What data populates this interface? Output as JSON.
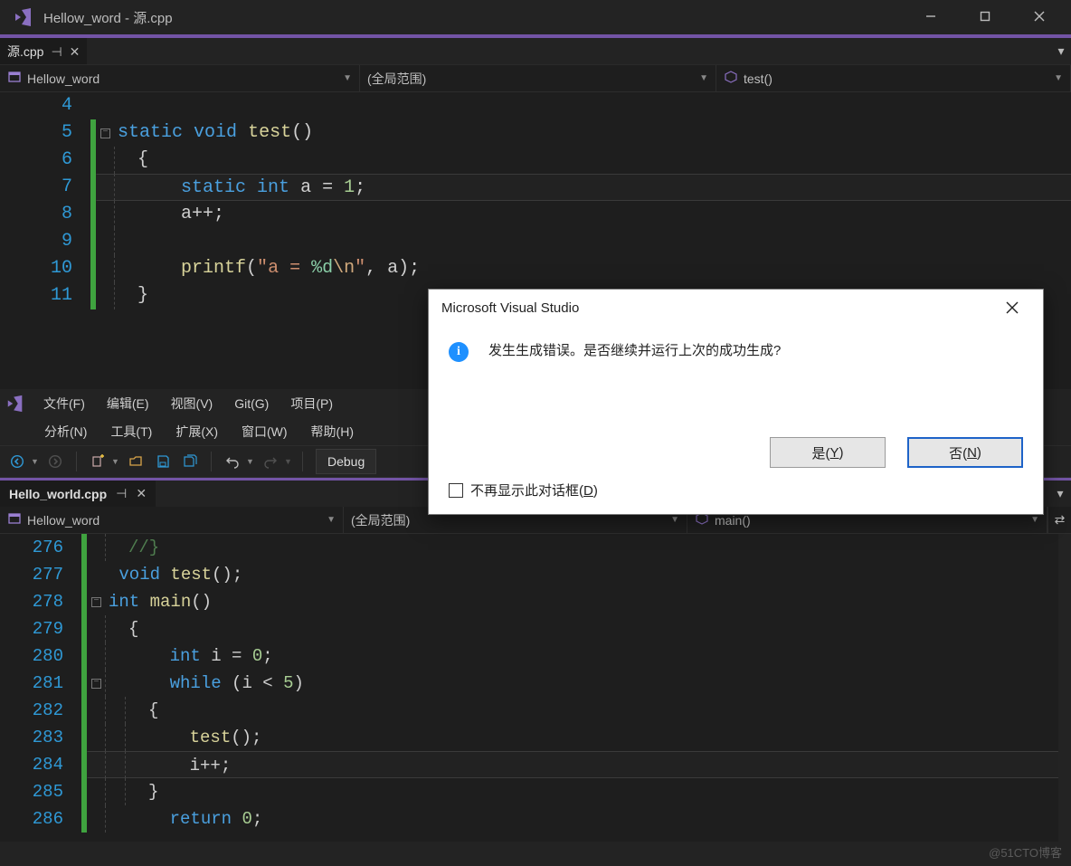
{
  "window1": {
    "title": "Hellow_word - 源.cpp",
    "tab": {
      "label": "源.cpp"
    },
    "nav": {
      "project": "Hellow_word",
      "scope": "(全局范围)",
      "member": "test()"
    },
    "lines": {
      "4": "",
      "5": {
        "kw1": "static",
        "kw2": "void",
        "fn": "test",
        "rest": "()"
      },
      "6": "{",
      "7": {
        "kw1": "static",
        "kw2": "int",
        "id": "a",
        "eq": "=",
        "num": "1",
        "semi": ";"
      },
      "8": {
        "id": "a",
        "op": "++",
        "semi": ";"
      },
      "9": "",
      "10": {
        "fn": "printf",
        "open": "(",
        "q1": "\"",
        "lit": "a = ",
        "fmt": "%d",
        "esc": "\\n",
        "q2": "\"",
        "comma": ", ",
        "arg": "a",
        "close": ")",
        "semi": ";"
      },
      "11": "}"
    }
  },
  "window2": {
    "menu_row1": [
      "文件(F)",
      "编辑(E)",
      "视图(V)",
      "Git(G)",
      "项目(P)"
    ],
    "menu_row2": [
      "分析(N)",
      "工具(T)",
      "扩展(X)",
      "窗口(W)",
      "帮助(H)"
    ],
    "toolbar": {
      "config": "Debug"
    },
    "tab": {
      "label": "Hello_world.cpp"
    },
    "nav": {
      "project": "Hellow_word",
      "scope": "(全局范围)",
      "member": "main()"
    },
    "lines": {
      "276": {
        "comm": "//}"
      },
      "277": {
        "kw": "void",
        "fn": "test",
        "rest": "();"
      },
      "278": {
        "kw": "int",
        "fn": "main",
        "rest": "()"
      },
      "279": "{",
      "280": {
        "kw": "int",
        "id": "i",
        "eq": "=",
        "num": "0",
        "semi": ";"
      },
      "281": {
        "kw": "while",
        "open": " (",
        "id": "i",
        "op": " < ",
        "num": "5",
        "close": ")"
      },
      "282": "{",
      "283": {
        "fn": "test",
        "rest": "();"
      },
      "284": {
        "id": "i",
        "op": "++",
        "semi": ";"
      },
      "285": "}",
      "286": {
        "kw": "return",
        "sp": " ",
        "num": "0",
        "semi": ";"
      }
    }
  },
  "dialog": {
    "title": "Microsoft Visual Studio",
    "message": "发生生成错误。是否继续并运行上次的成功生成?",
    "yes_prefix": "是(",
    "yes_hotkey": "Y",
    "yes_suffix": ")",
    "no_prefix": "否(",
    "no_hotkey": "N",
    "no_suffix": ")",
    "checkbox_prefix": "不再显示此对话框(",
    "checkbox_hotkey": "D",
    "checkbox_suffix": ")"
  },
  "watermark": "@51CTO博客"
}
